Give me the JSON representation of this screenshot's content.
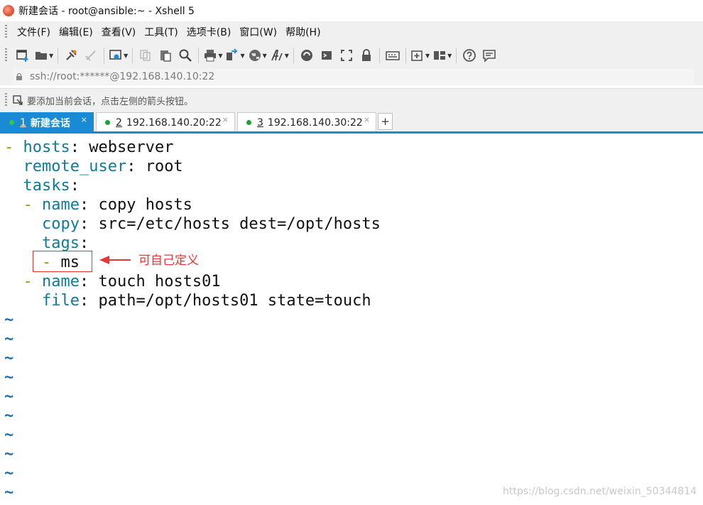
{
  "window": {
    "title": "新建会话 - root@ansible:~ - Xshell 5"
  },
  "menu": [
    "文件(F)",
    "编辑(E)",
    "查看(V)",
    "工具(T)",
    "选项卡(B)",
    "窗口(W)",
    "帮助(H)"
  ],
  "toolbar": {
    "icons": [
      "new-session-icon",
      "open-folder-icon",
      "connect-icon",
      "disconnect-icon",
      "properties-icon",
      "copy-icon",
      "paste-icon",
      "find-icon",
      "print-icon",
      "transfer-icon",
      "globe-icon",
      "font-icon",
      "xftp-icon",
      "xshell-icon",
      "fullscreen-icon",
      "lock-icon",
      "keyboard-icon",
      "new-tab-icon",
      "layout-icon",
      "help-icon",
      "chat-icon"
    ]
  },
  "address": {
    "value": "ssh://root:******@192.168.140.10:22"
  },
  "hint": {
    "text": "要添加当前会话，点击左侧的箭头按钮。"
  },
  "tabs": [
    {
      "num": "1",
      "label": "新建会话",
      "active": true,
      "dot_color": "#2ecc40"
    },
    {
      "num": "2",
      "label": "192.168.140.20:22",
      "active": false,
      "dot_color": "#17a62f"
    },
    {
      "num": "3",
      "label": "192.168.140.30:22",
      "active": false,
      "dot_color": "#17a62f"
    }
  ],
  "tab_close_glyph": "×",
  "tab_add_glyph": "+",
  "terminal": {
    "l1_dash": "-",
    "l1_key": "hosts",
    "l1_colon": ":",
    "l1_val": " webserver",
    "l2_key": "remote_user",
    "l2_colon": ":",
    "l2_val": " root",
    "l3_key": "tasks",
    "l3_colon": ":",
    "l4_dash": "-",
    "l4_key": "name",
    "l4_colon": ":",
    "l4_val": " copy hosts",
    "l5_key": "copy",
    "l5_colon": ":",
    "l5_val": " src=/etc/hosts dest=/opt/hosts",
    "l6_key": "tags",
    "l6_colon": ":",
    "l7_dash": "-",
    "l7_val": " ms",
    "l8_dash": "-",
    "l8_key": "name",
    "l8_colon": ":",
    "l8_val": " touch hosts01",
    "l9_key": "file",
    "l9_colon": ":",
    "l9_val": " path=/opt/hosts01 state=touch",
    "tilde": "~"
  },
  "annotation": {
    "text": "可自己定义",
    "color": "#e53935"
  },
  "watermark": "https://blog.csdn.net/weixin_50344814"
}
